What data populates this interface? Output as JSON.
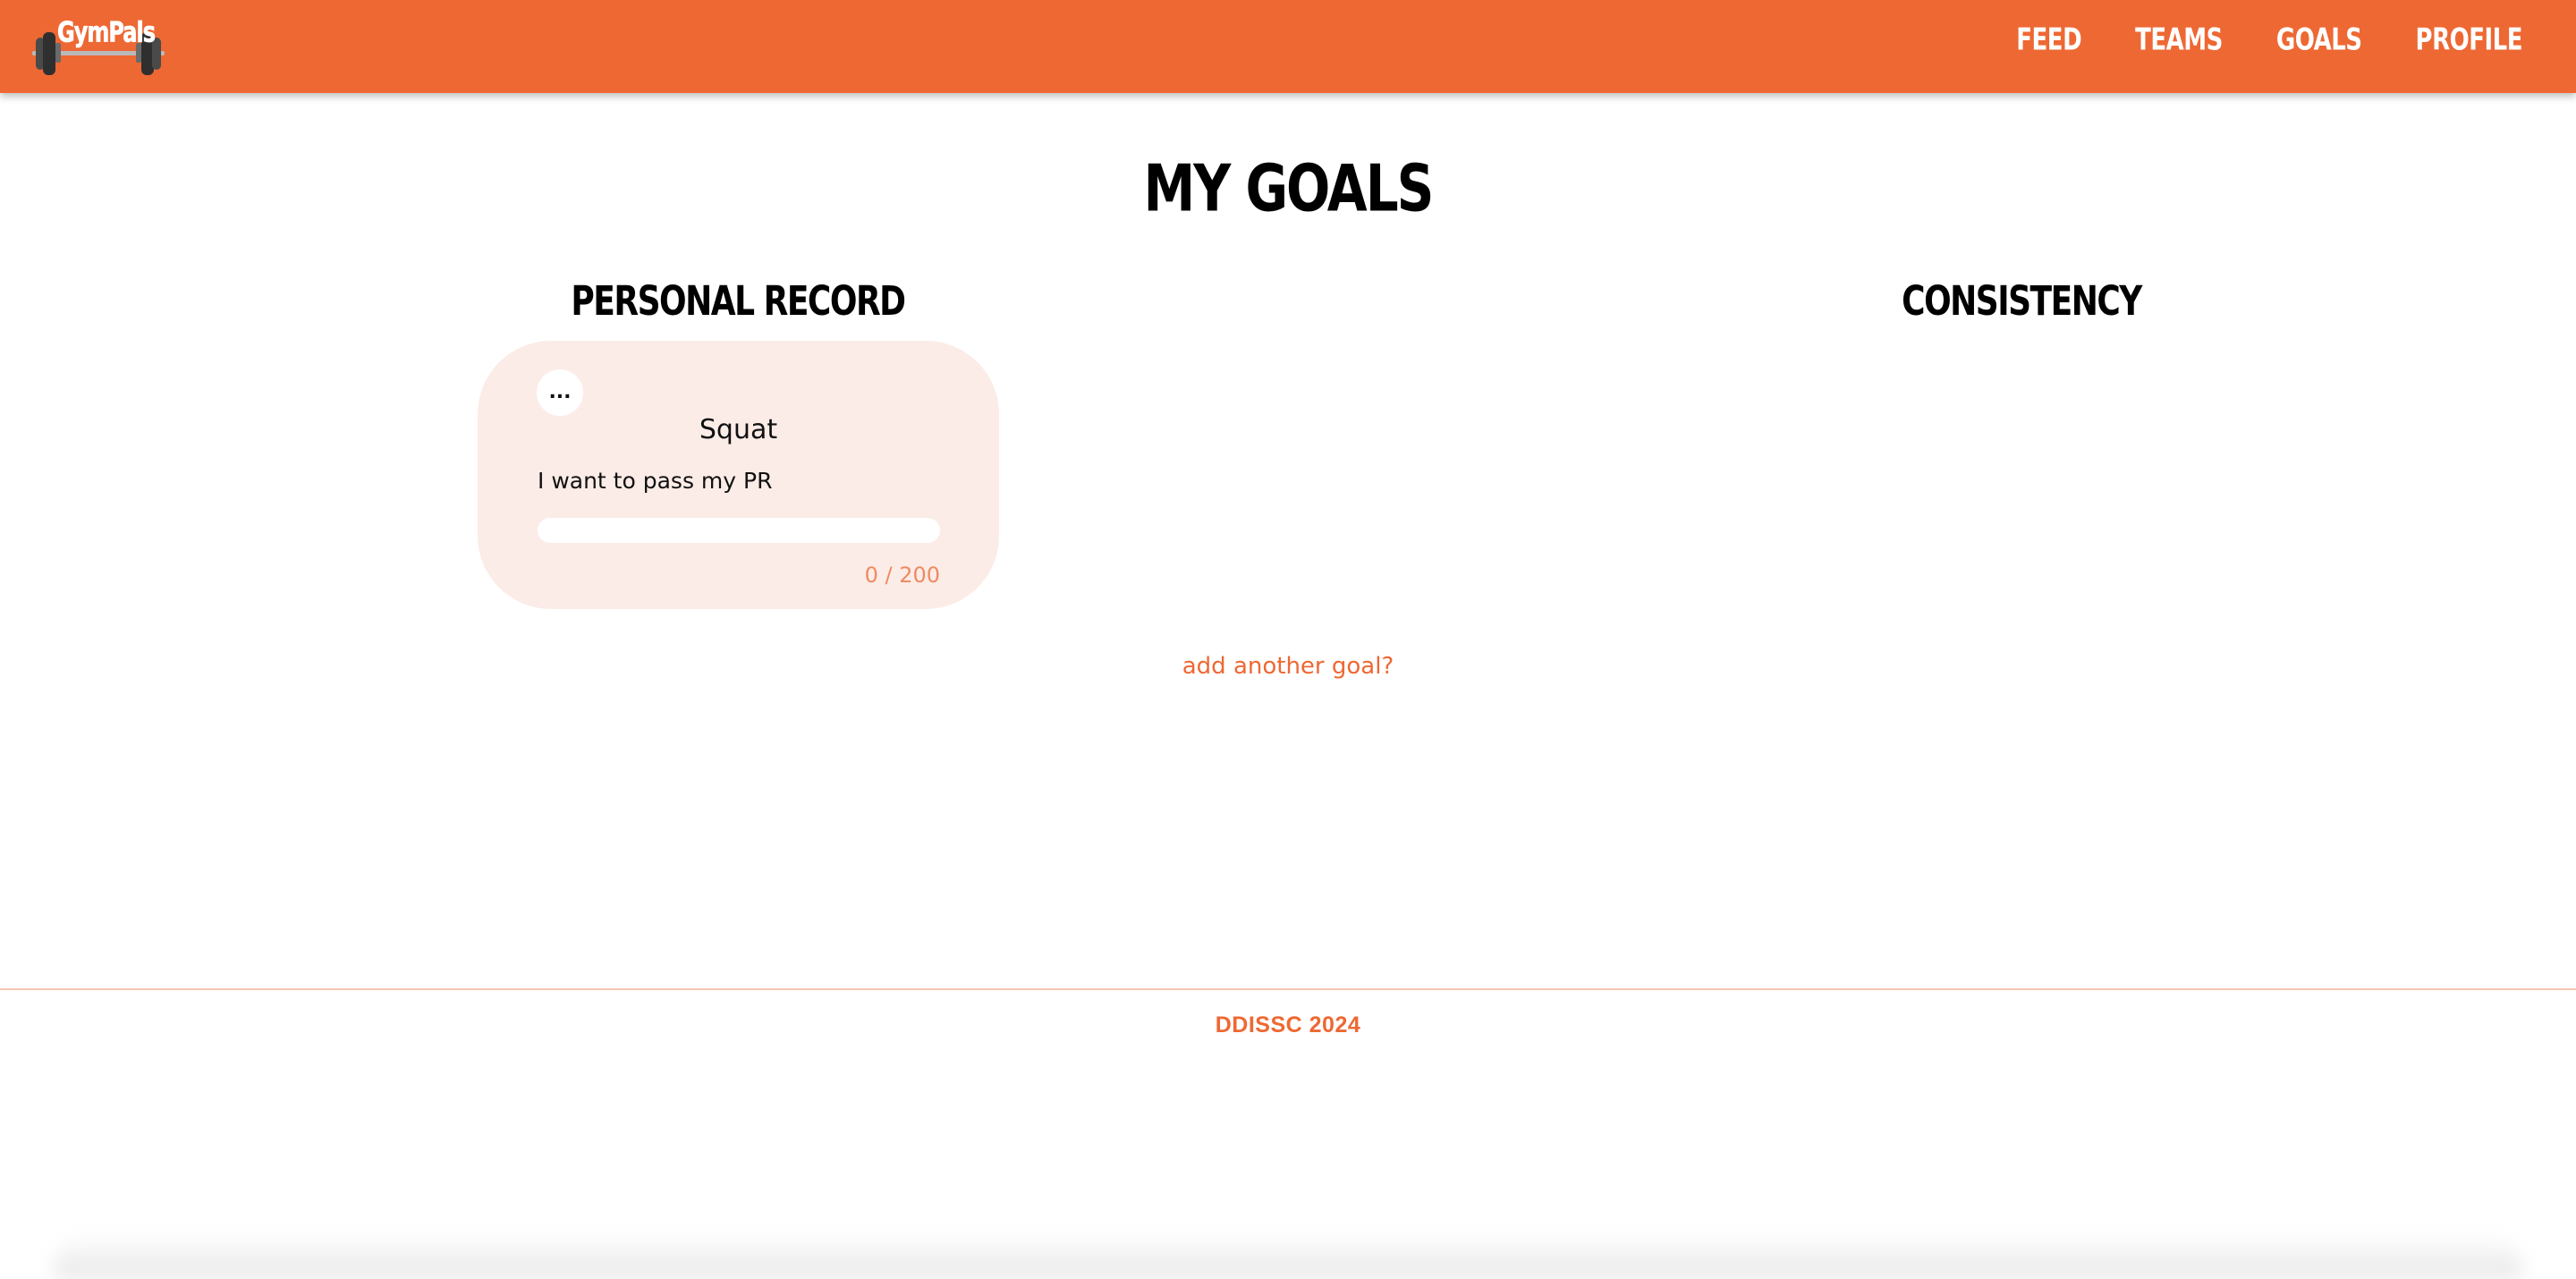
{
  "navbar": {
    "logo_text": "GymPals",
    "links": [
      "FEED",
      "TEAMS",
      "GOALS",
      "PROFILE"
    ]
  },
  "page": {
    "title": "MY GOALS",
    "sections": {
      "personal_record": "PERSONAL RECORD",
      "consistency": "CONSISTENCY"
    }
  },
  "goals": [
    {
      "menu_label": "...",
      "name": "Squat",
      "description": "I want to pass my PR",
      "progress_text": "0 / 200",
      "progress_current": 0,
      "progress_target": 200
    }
  ],
  "add_goal_label": "add another goal?",
  "footer": {
    "text": "DDISSC 2024"
  },
  "colors": {
    "accent": "#ee6833",
    "card_background": "#fbece7",
    "progress_text": "#ee8a62"
  },
  "icons": {
    "logo": "barbell-icon"
  }
}
